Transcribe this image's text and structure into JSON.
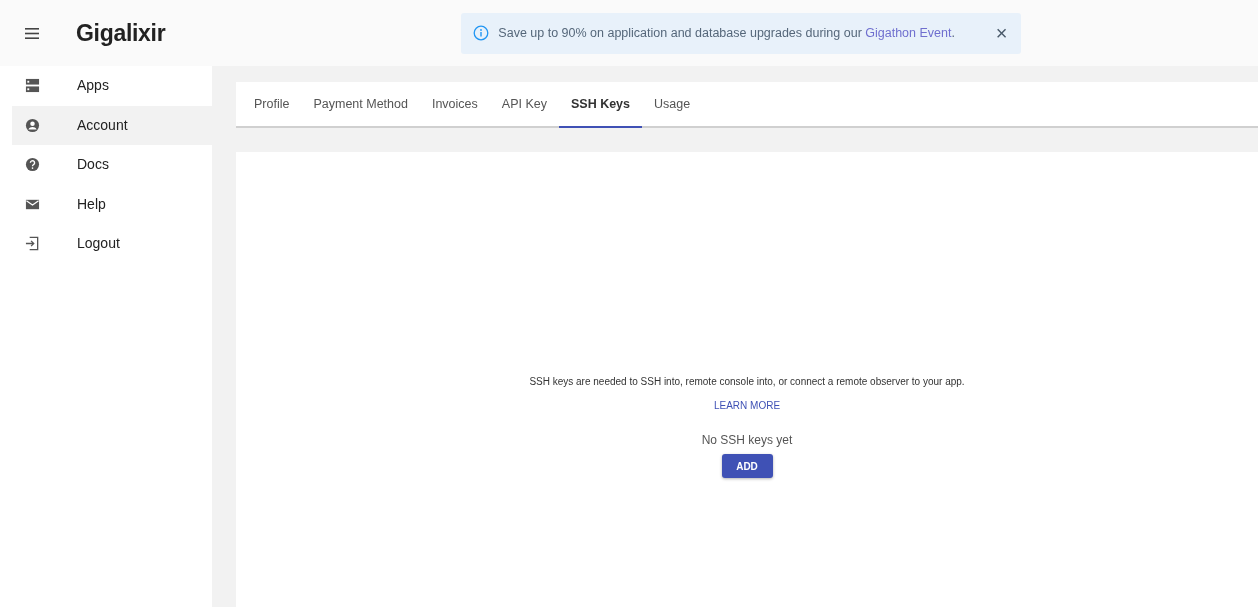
{
  "header": {
    "logo": "Gigalixir"
  },
  "banner": {
    "text": "Save up to 90% on application and database upgrades during our ",
    "link": "Gigathon Event",
    "suffix": ".",
    "close": "×"
  },
  "sidebar": {
    "items": [
      {
        "label": "Apps",
        "selected": false
      },
      {
        "label": "Account",
        "selected": true
      },
      {
        "label": "Docs",
        "selected": false
      },
      {
        "label": "Help",
        "selected": false
      },
      {
        "label": "Logout",
        "selected": false
      }
    ]
  },
  "tabs": [
    {
      "label": "Profile",
      "selected": false
    },
    {
      "label": "Payment Method",
      "selected": false
    },
    {
      "label": "Invoices",
      "selected": false
    },
    {
      "label": "API Key",
      "selected": false
    },
    {
      "label": "SSH Keys",
      "selected": true
    },
    {
      "label": "Usage",
      "selected": false
    }
  ],
  "content": {
    "description": "SSH keys are needed to SSH into, remote console into, or connect a remote observer to your app.",
    "learn_more": "LEARN MORE",
    "empty": "No SSH keys yet",
    "add_button": "ADD"
  }
}
